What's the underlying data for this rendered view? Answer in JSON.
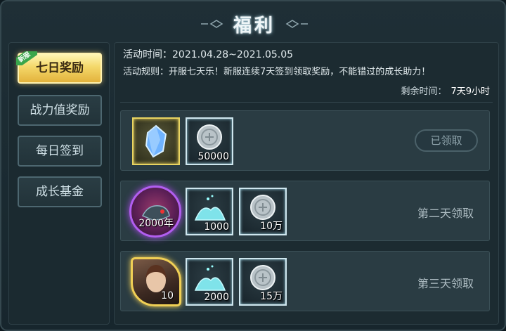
{
  "window": {
    "title": "福利"
  },
  "sidebar": {
    "tabs": [
      {
        "label": "七日奖励",
        "active": true,
        "badge": "新服"
      },
      {
        "label": "战力值奖励",
        "active": false
      },
      {
        "label": "每日签到",
        "active": false
      },
      {
        "label": "成长基金",
        "active": false
      }
    ]
  },
  "info": {
    "time": "活动时间：2021.04.28~2021.05.05",
    "rules": "活动规则：开服七天乐！新服连续7天签到领取奖励，不能错过的成长助力！",
    "remaining_label": "剩余时间：",
    "remaining_value": "7天9小时"
  },
  "rewards": [
    {
      "items": [
        {
          "icon": "blue-crystal-icon",
          "qty": ""
        },
        {
          "icon": "silver-coin-icon",
          "qty": "50000"
        }
      ],
      "status": "已领取"
    },
    {
      "items": [
        {
          "icon": "mount-portrait-icon",
          "qty": "2000年"
        },
        {
          "icon": "crystal-shards-icon",
          "qty": "1000"
        },
        {
          "icon": "silver-coin-icon",
          "qty": "10万"
        }
      ],
      "status": "第二天领取"
    },
    {
      "items": [
        {
          "icon": "hero-portrait-icon",
          "qty": "10"
        },
        {
          "icon": "crystal-shards-icon",
          "qty": "2000"
        },
        {
          "icon": "silver-coin-icon",
          "qty": "15万"
        }
      ],
      "status": "第三天领取"
    }
  ],
  "colors": {
    "accent_gold": "#f4d86a",
    "frame_cyan": "#cfe7ef",
    "purple_glow": "#b25ef0",
    "badge_green": "#3aa64b"
  }
}
